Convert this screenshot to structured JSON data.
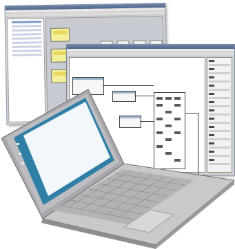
{
  "scene": {
    "back_window": {
      "title_color": "#5a7094",
      "tree_item_count": 9,
      "card_color": "#f3ef9a"
    },
    "front_window": {
      "title_color": "#5a7094",
      "canvas_color": "#ffffff"
    },
    "laptop": {
      "body_color": "#c9c9cb",
      "screen_color": "#2f7fa6",
      "screen_content_color": "#f2f7fb"
    }
  }
}
